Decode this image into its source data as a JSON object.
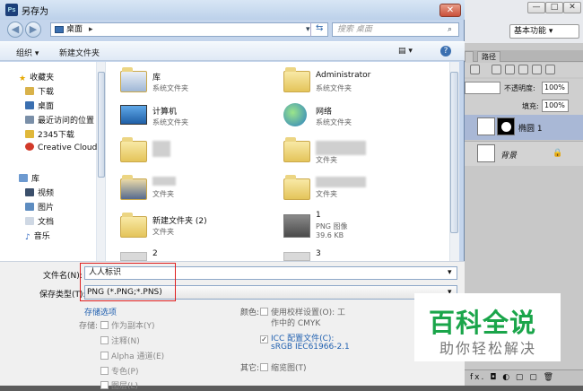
{
  "dialog": {
    "title": "另存为",
    "close": "✕",
    "title_icon": "Ps"
  },
  "nav": {
    "back": "◀",
    "forward": "▶",
    "address": "桌面",
    "address_arrow": "▸",
    "search_placeholder": "搜索 桌面"
  },
  "toolbar": {
    "organize": "组织 ▾",
    "new_folder": "新建文件夹",
    "view": "▤ ▾",
    "help": "?"
  },
  "sidebar": {
    "favorites": "收藏夹",
    "fav_items": [
      "下载",
      "桌面",
      "最近访问的位置",
      "2345下载",
      "Creative Cloud"
    ],
    "libraries": "库",
    "lib_items": [
      "视频",
      "图片",
      "文档",
      "音乐"
    ]
  },
  "files": [
    {
      "name": "库",
      "sub": "系统文件夹"
    },
    {
      "name": "Administrator",
      "sub": "系统文件夹"
    },
    {
      "name": "计算机",
      "sub": "系统文件夹"
    },
    {
      "name": "网络",
      "sub": "系统文件夹"
    },
    {
      "name": "",
      "sub": "文件夹"
    },
    {
      "name": "",
      "sub": "文件夹"
    },
    {
      "name": "",
      "sub": "文件夹"
    },
    {
      "name": "",
      "sub": "文件夹"
    },
    {
      "name": "新建文件夹 (2)",
      "sub": "文件夹"
    },
    {
      "name": "1",
      "sub": "PNG 图像",
      "size": "39.6 KB"
    },
    {
      "name": "2",
      "sub": ""
    },
    {
      "name": "3",
      "sub": ""
    }
  ],
  "form": {
    "filename_label": "文件名(N):",
    "filename_value": "人人标识",
    "filetype_label": "保存类型(T):",
    "filetype_value": "PNG (*.PNG;*.PNS)",
    "save_options": "存储选项",
    "storage_label": "存储:",
    "as_copy": "作为副本(Y)",
    "notes": "注释(N)",
    "alpha": "Alpha 通道(E)",
    "spot": "专色(P)",
    "layers": "图层(L)",
    "color_label": "颜色:",
    "proof": "使用校样设置(O): 工",
    "proof2": "作中的 CMYK",
    "icc": "ICC 配置文件(C):",
    "icc2": "sRGB IEC61966-2.1",
    "other_label": "其它:",
    "thumb": "缩览图(T)"
  },
  "photoshop": {
    "min": "—",
    "max": "□",
    "close": "✕",
    "workspace": "基本功能 ▾",
    "tab": "路径",
    "opacity_label": "不透明度:",
    "opacity": "100%",
    "fill_label": "填充:",
    "fill": "100%",
    "layer1": "椭圆 1",
    "layer2": "背景",
    "lock": "🔒",
    "bottom": "fx. ◘ ◐ ▢ ▢ 🗑"
  },
  "watermark": {
    "main": "百科全说",
    "sub": "助你轻松解决"
  }
}
